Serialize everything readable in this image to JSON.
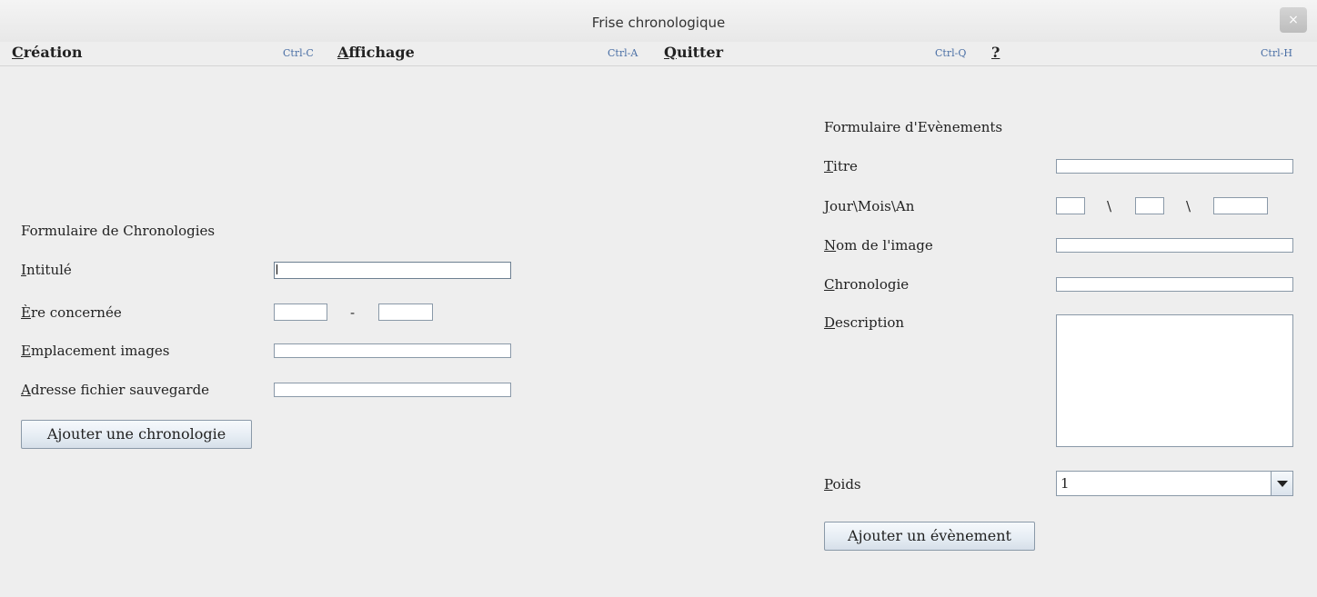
{
  "window": {
    "title": "Frise chronologique",
    "close_glyph": "×"
  },
  "menu": [
    {
      "mnemonic": "C",
      "rest": "réation",
      "accel": "Ctrl-C"
    },
    {
      "mnemonic": "A",
      "rest": "ffichage",
      "accel": "Ctrl-A"
    },
    {
      "mnemonic": "Q",
      "rest": "uitter",
      "accel": "Ctrl-Q"
    },
    {
      "mnemonic": "?",
      "rest": "",
      "accel": "Ctrl-H"
    }
  ],
  "chrono_form": {
    "heading": "Formulaire de Chronologies",
    "intitule": {
      "mnemonic": "I",
      "rest": "ntitulé",
      "value": ""
    },
    "ere": {
      "mnemonic": "È",
      "rest": "re concernée",
      "separator": "-",
      "start": "",
      "end": ""
    },
    "emplacement": {
      "mnemonic": "E",
      "rest": "mplacement images",
      "value": ""
    },
    "adresse": {
      "mnemonic": "A",
      "rest": "dresse fichier sauvegarde",
      "value": ""
    },
    "submit_label": "Ajouter une chronologie"
  },
  "event_form": {
    "heading": "Formulaire d'Evènements",
    "titre": {
      "mnemonic": "T",
      "rest": "itre",
      "value": ""
    },
    "date": {
      "mnemonic": "J",
      "rest": "our\\Mois\\An",
      "separator": "\\",
      "day": "",
      "month": "",
      "year": ""
    },
    "image": {
      "mnemonic": "N",
      "rest": "om de l'image",
      "value": ""
    },
    "chronologie": {
      "mnemonic": "C",
      "rest": "hronologie",
      "value": ""
    },
    "description": {
      "mnemonic": "D",
      "rest": "escription",
      "value": ""
    },
    "poids": {
      "mnemonic": "P",
      "rest": "oids",
      "selected": "1"
    },
    "submit_label": "Ajouter un évènement"
  },
  "icons": {
    "close": "close-icon",
    "dropdown": "chevron-down-icon"
  }
}
